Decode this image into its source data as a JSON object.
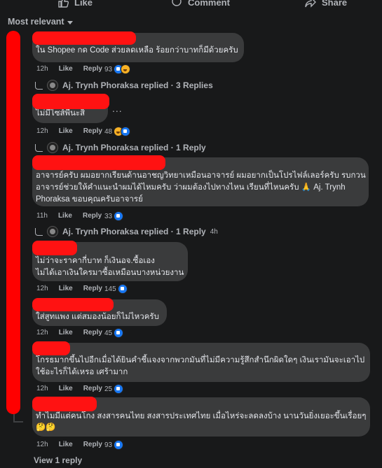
{
  "top_actions": {
    "like": "Like",
    "comment": "Comment",
    "share": "Share"
  },
  "sort": {
    "label": "Most relevant"
  },
  "comments": [
    {
      "text": [
        "ใน Shopee กด Code ส่วยลดเหลือ ร้อยกว่าบาทก็มีด้วยครับ"
      ],
      "time": "12h",
      "like": "Like",
      "reply": "Reply",
      "count": "93",
      "reactions": [
        "like",
        "haha"
      ],
      "replies": "Aj. Trynh Phoraksa replied · 3 Replies",
      "replies_ago": ""
    },
    {
      "text": [
        "ไม่มีไซส์พี่นะสิ"
      ],
      "time": "12h",
      "like": "Like",
      "reply": "Reply",
      "count": "48",
      "reactions": [
        "haha",
        "like"
      ],
      "replies": "Aj. Trynh Phoraksa replied · 1 Reply",
      "replies_ago": ""
    },
    {
      "text": [
        "อาจารย์ครับ ผมอยากเรียนด้านอาชญวิทยาเหมือนอาจารย์ ผมอยากเป็นโปรไฟล์เลอร์ครับ รบกวน",
        "อาจารย์ช่วยให้คำแนะนำผมได้ไหมครับ ว่าผมต้องไปทางไหน เรียนที่ไหนครับ 🙏 Aj. Trynh",
        "Phoraksa ขอบคุณครับอาจารย์"
      ],
      "time": "11h",
      "like": "Like",
      "reply": "Reply",
      "count": "33",
      "reactions": [
        "like"
      ],
      "replies": "Aj. Trynh Phoraksa replied · 1 Reply",
      "replies_ago": "4h"
    },
    {
      "text": [
        "ไม่ว่าจะราคากี่บาท ก็เงินอจ.ซื้อเอง",
        "ไม่ได้เอาเงินใครมาซื้อเหมือนบางหน่วยงาน"
      ],
      "time": "12h",
      "like": "Like",
      "reply": "Reply",
      "count": "145",
      "reactions": [
        "like"
      ]
    },
    {
      "text": [
        "ใส่สูทแพง แต่สมองน้อยก็ไม่ไหวครับ"
      ],
      "time": "12h",
      "like": "Like",
      "reply": "Reply",
      "count": "45",
      "reactions": [
        "like"
      ]
    },
    {
      "text": [
        "โกรธมากขึ้นไปอีกเมื่อได้ยินคำชี้แจงจากพวกมันที่ไม่มีความรู้สึกสำนึกผิดใดๆ เงินเรามันจะเอาไป",
        "ใช้อะไรก็ได้เหรอ เศร้ามาก"
      ],
      "time": "12h",
      "like": "Like",
      "reply": "Reply",
      "count": "25",
      "reactions": [
        "like"
      ]
    },
    {
      "text": [
        "ทำไมมีแต่คนโกง สงสารคนไทย สงสารประเทศไทย เมื่อไหร่จะลดลงบ้าง นานวันยิ่งเยอะขึ้นเรื่อยๆ",
        "🤔🤔"
      ],
      "time": "12h",
      "like": "Like",
      "reply": "Reply",
      "count": "93",
      "reactions": [
        "like"
      ]
    }
  ],
  "more_options": "...",
  "view_reply": "View 1 reply"
}
